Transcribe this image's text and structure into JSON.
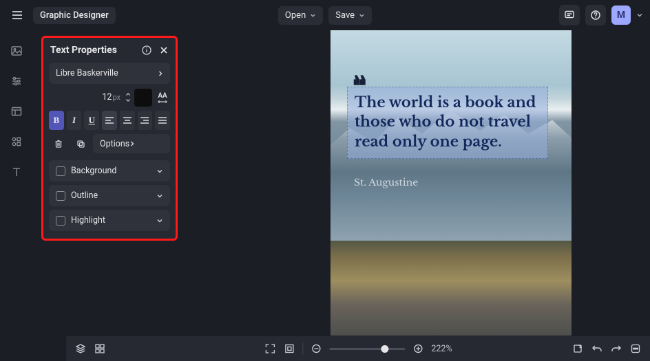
{
  "app": {
    "title": "Graphic Designer"
  },
  "topbar": {
    "open": "Open",
    "save": "Save",
    "avatar_initial": "M"
  },
  "panel": {
    "title": "Text Properties",
    "font_family": "Libre Baskerville",
    "font_size": "12",
    "font_unit": "px",
    "color": "#0d0d0d",
    "bold": "B",
    "italic": "I",
    "underline": "U",
    "options": "Options",
    "sections": {
      "background": "Background",
      "outline": "Outline",
      "highlight": "Highlight"
    }
  },
  "canvas": {
    "quote_glyph": "❝",
    "quote": "The world is a book and those who do not travel read only one page.",
    "author": "St. Augustine"
  },
  "bottombar": {
    "zoom": "222%"
  },
  "icons": {
    "menu": "menu",
    "chat": "chat",
    "help": "help",
    "chevdown": "chevdown",
    "image": "image",
    "sliders": "sliders",
    "panel_split": "panel",
    "shapes": "shapes",
    "text": "text",
    "info": "info",
    "close": "close",
    "chevright": "chevright",
    "stepper_up": "up",
    "stepper_down": "down",
    "align_left": "al",
    "align_center": "ac",
    "align_right": "ar",
    "align_just": "aj",
    "trash": "trash",
    "duplicate": "dup",
    "layers": "layers",
    "grid": "grid",
    "fit": "fit",
    "fullscreen": "full",
    "minus": "minus",
    "plus": "plus",
    "transform": "transform",
    "undo": "undo",
    "redo": "redo",
    "more": "more"
  }
}
